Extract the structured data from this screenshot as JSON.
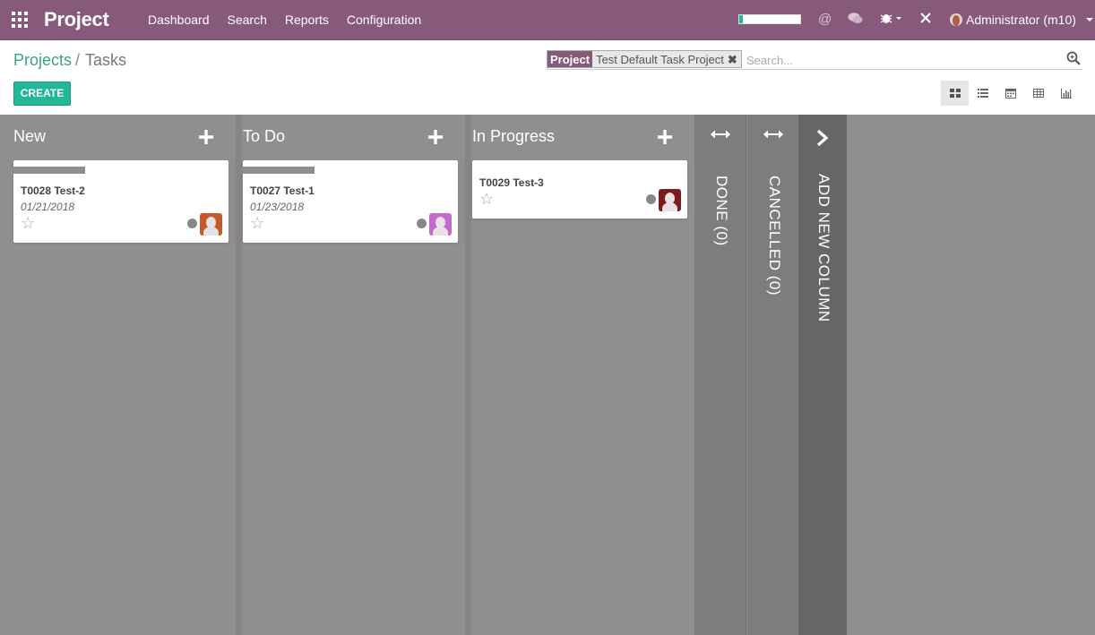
{
  "navbar": {
    "app_name": "Project",
    "menu": [
      "Dashboard",
      "Search",
      "Reports",
      "Configuration"
    ],
    "progress_fraction": 0.06,
    "user_label": "Administrator (m10)"
  },
  "breadcrumb": {
    "parent": "Projects",
    "separator": "/",
    "current": "Tasks"
  },
  "control": {
    "create_label": "CREATE"
  },
  "search": {
    "facet_category": "Project",
    "facet_value": "Test Default Task Project",
    "facet_remove": "✖",
    "placeholder": "Search..."
  },
  "views": [
    "kanban",
    "list",
    "calendar",
    "pivot",
    "graph"
  ],
  "columns": [
    {
      "title": "New",
      "cards": [
        {
          "title": "T0028 Test-2",
          "date": "01/21/2018",
          "avatar_color": "#c45a2a"
        }
      ]
    },
    {
      "title": "To Do",
      "cards": [
        {
          "title": "T0027 Test-1",
          "date": "01/23/2018",
          "avatar_color": "#c26bc8"
        }
      ]
    },
    {
      "title": "In Progress",
      "cards": [
        {
          "title": "T0029 Test-3",
          "date": "",
          "avatar_color": "#7a1c1c"
        }
      ]
    }
  ],
  "folded_columns": [
    {
      "label": "DONE (0)"
    },
    {
      "label": "CANCELLED (0)"
    }
  ],
  "add_column_label": "ADD NEW COLUMN",
  "colors": {
    "brand": "#875a7b",
    "accent": "#21b799",
    "kanban_bg": "#8f8f8f"
  }
}
